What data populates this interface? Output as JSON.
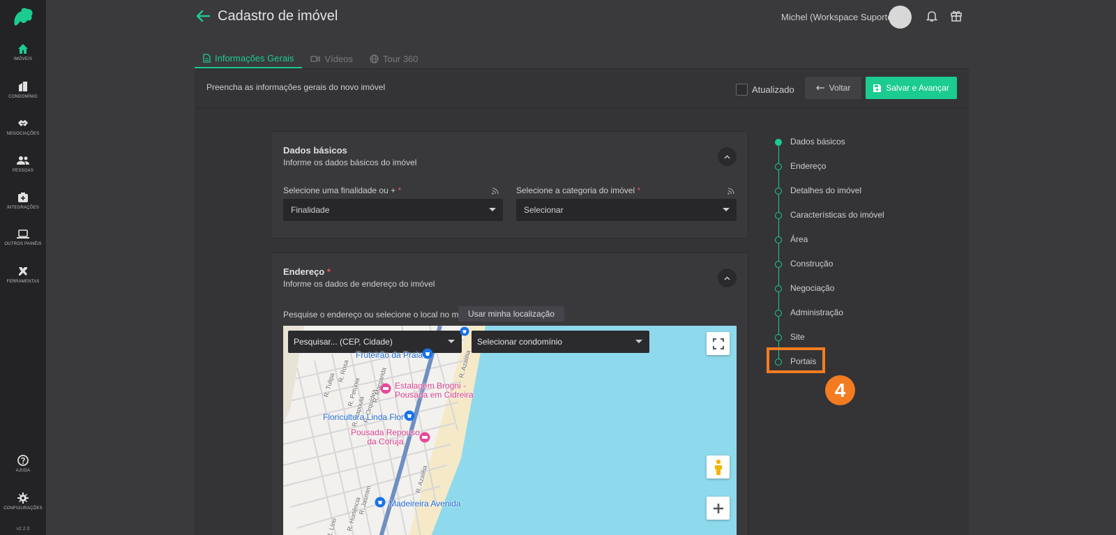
{
  "sidebar": {
    "items": [
      {
        "label": "IMÓVEIS",
        "icon": "home-icon"
      },
      {
        "label": "CONDOMÍNIO",
        "icon": "building-icon"
      },
      {
        "label": "NEGOCIAÇÕES",
        "icon": "handshake-icon"
      },
      {
        "label": "PESSOAS",
        "icon": "people-icon"
      },
      {
        "label": "INTEGRAÇÕES",
        "icon": "integrations-icon"
      },
      {
        "label": "OUTROS PAINÉIS",
        "icon": "laptop-icon"
      },
      {
        "label": "FERRAMENTAS",
        "icon": "tools-icon"
      }
    ],
    "help_label": "AJUDA",
    "settings_label": "CONFIGURAÇÕES",
    "version": "v2.2.0"
  },
  "header": {
    "title": "Cadastro de imóvel",
    "user": "Michel (Workspace Suporte)"
  },
  "tabs": [
    {
      "label": "Informações Gerais",
      "active": true
    },
    {
      "label": "Vídeos",
      "active": false
    },
    {
      "label": "Tour 360",
      "active": false
    }
  ],
  "toolbar": {
    "description": "Preencha as informações gerais do novo imóvel",
    "checkbox_label": "Atualizado",
    "back_label": "Voltar",
    "save_label": "Salvar e Avançar"
  },
  "basic": {
    "title": "Dados básicos",
    "subtitle": "Informe os dados básicos do imóvel",
    "purpose_label": "Selecione uma finalidade ou +",
    "purpose_value": "Finalidade",
    "category_label": "Selecione a categoria do imóvel",
    "category_value": "Selecionar"
  },
  "address": {
    "title": "Endereço",
    "subtitle": "Informe os dados de endereço do imóvel",
    "search_label": "Pesquise o endereço ou selecione o local no mapa:",
    "location_button": "Usar minha localização",
    "search_placeholder": "Pesquisar... (CEP, Cidade)",
    "condo_placeholder": "Selecionar condomínio"
  },
  "map": {
    "places": [
      {
        "label": "Fruteirão da Praia"
      },
      {
        "label": "Estalagem Brogni -"
      },
      {
        "label": "Pousada em Cidreira"
      },
      {
        "label": "Floricultura Linda Flor"
      },
      {
        "label": "Pousada Repouso"
      },
      {
        "label": "da Coruja"
      },
      {
        "label": "Madeireira Avenida"
      }
    ],
    "streets": [
      "R. Tulipa",
      "R. Rosa",
      "R. Petúnia",
      "R. Papoula",
      "R. Orquídea",
      "R. Margarida",
      "R. Azaléia",
      "R. Azaléia",
      "R. Jasmim",
      "R. Hortência",
      "R. Lírio"
    ]
  },
  "steps": [
    {
      "label": "Dados básicos",
      "done": true
    },
    {
      "label": "Endereço",
      "done": false
    },
    {
      "label": "Detalhes do imóvel",
      "done": false
    },
    {
      "label": "Características do imóvel",
      "done": false
    },
    {
      "label": "Área",
      "done": false
    },
    {
      "label": "Construção",
      "done": false
    },
    {
      "label": "Negociação",
      "done": false
    },
    {
      "label": "Administração",
      "done": false
    },
    {
      "label": "Site",
      "done": false
    },
    {
      "label": "Portais",
      "done": false
    }
  ],
  "annotation": {
    "badge": "4"
  },
  "colors": {
    "accent": "#1ccb8f",
    "highlight": "#f47c20",
    "required": "#e8545c"
  }
}
